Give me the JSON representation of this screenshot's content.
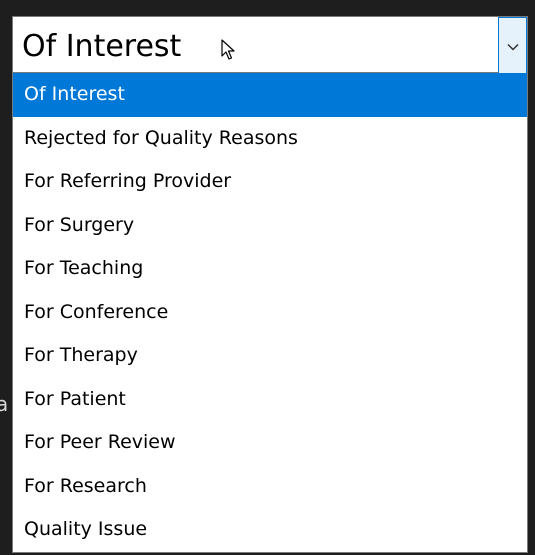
{
  "background_fragment": "a",
  "dropdown": {
    "selected_value": "Of Interest",
    "options": [
      {
        "label": "Of Interest",
        "selected": true
      },
      {
        "label": "Rejected for Quality Reasons",
        "selected": false
      },
      {
        "label": "For Referring Provider",
        "selected": false
      },
      {
        "label": "For Surgery",
        "selected": false
      },
      {
        "label": "For Teaching",
        "selected": false
      },
      {
        "label": "For Conference",
        "selected": false
      },
      {
        "label": "For Therapy",
        "selected": false
      },
      {
        "label": "For Patient",
        "selected": false
      },
      {
        "label": "For Peer Review",
        "selected": false
      },
      {
        "label": "For Research",
        "selected": false
      },
      {
        "label": "Quality Issue",
        "selected": false
      }
    ]
  },
  "colors": {
    "highlight": "#0078d7",
    "highlight_text": "#ffffff",
    "button_bg": "#e5f1fb",
    "backdrop": "#1e1e1e"
  },
  "icons": {
    "cursor": "mouse-pointer-icon",
    "chevron": "chevron-down-icon"
  }
}
